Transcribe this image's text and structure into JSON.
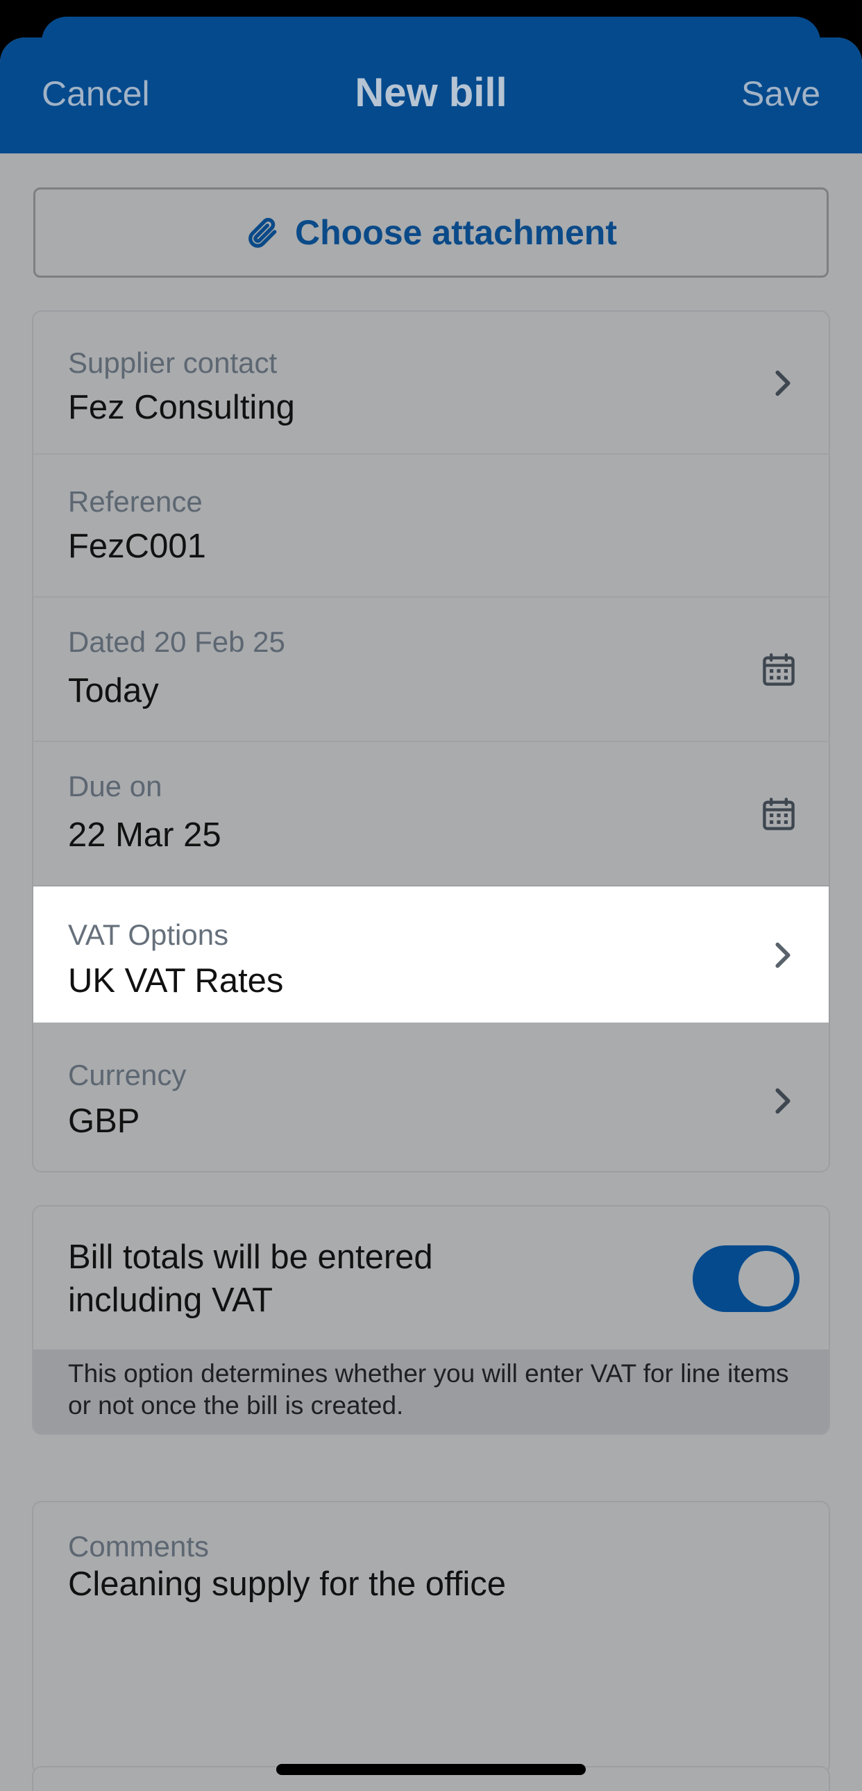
{
  "nav": {
    "cancel_label": "Cancel",
    "title": "New bill",
    "save_label": "Save"
  },
  "attachment": {
    "label": "Choose attachment",
    "icon": "paperclip-icon"
  },
  "fields": {
    "supplier": {
      "label": "Supplier contact",
      "value": "Fez Consulting",
      "icon": "chevron-right-icon"
    },
    "reference": {
      "label": "Reference",
      "value": "FezC001"
    },
    "dated": {
      "label": "Dated 20 Feb 25",
      "value": "Today",
      "icon": "calendar-icon"
    },
    "due": {
      "label": "Due on",
      "value": "22 Mar 25",
      "icon": "calendar-icon"
    },
    "vat": {
      "label": "VAT Options",
      "value": "UK VAT Rates",
      "icon": "chevron-right-icon"
    },
    "currency": {
      "label": "Currency",
      "value": "GBP",
      "icon": "chevron-right-icon"
    }
  },
  "vat_toggle": {
    "line1": "Bill totals will be entered",
    "line2": "including VAT",
    "on": true,
    "note": "This option determines whether you will enter VAT for line items or not once the bill is created."
  },
  "comments": {
    "label": "Comments",
    "value": "Cleaning supply for the office"
  },
  "colors": {
    "brand": "#054a8d",
    "overlay_bg": "#a9abad",
    "highlight": "#ffffff"
  }
}
